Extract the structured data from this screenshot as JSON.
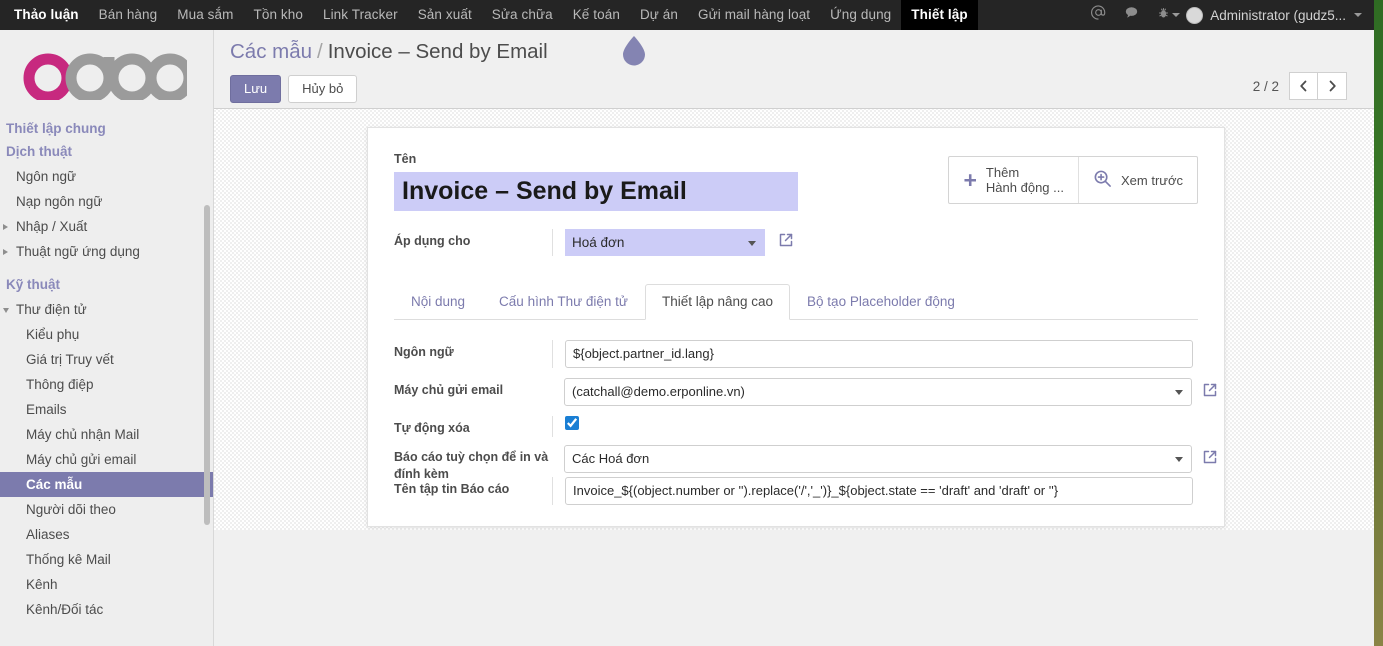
{
  "topbar": {
    "menus": [
      {
        "label": "Thảo luận",
        "state": "first"
      },
      {
        "label": "Bán hàng",
        "state": "normal"
      },
      {
        "label": "Mua sắm",
        "state": "normal"
      },
      {
        "label": "Tồn kho",
        "state": "normal"
      },
      {
        "label": "Link Tracker",
        "state": "normal"
      },
      {
        "label": "Sản xuất",
        "state": "normal"
      },
      {
        "label": "Sửa chữa",
        "state": "normal"
      },
      {
        "label": "Kế toán",
        "state": "normal"
      },
      {
        "label": "Dự án",
        "state": "normal"
      },
      {
        "label": "Gửi mail hàng loạt",
        "state": "normal"
      },
      {
        "label": "Ứng dụng",
        "state": "normal"
      },
      {
        "label": "Thiết lập",
        "state": "active"
      }
    ],
    "icons": [
      {
        "name": "at-icon",
        "glyph": "@"
      },
      {
        "name": "chat-bubble-icon",
        "glyph": "💬"
      },
      {
        "name": "bug-icon",
        "glyph": "⚘"
      }
    ],
    "username": "Administrator (gudz5..."
  },
  "sidebar": {
    "logo_text": "odoo",
    "items": [
      {
        "label": "Thiết lập chung",
        "type": "group",
        "name": "sidebar-group-general-settings"
      },
      {
        "label": "Dịch thuật",
        "type": "group",
        "name": "sidebar-group-translations"
      },
      {
        "label": "Ngôn ngữ",
        "type": "link",
        "name": "sidebar-item-languages",
        "arrow": "none"
      },
      {
        "label": "Nạp ngôn ngữ",
        "type": "link",
        "name": "sidebar-item-load-language",
        "arrow": "none"
      },
      {
        "label": "Nhập / Xuất",
        "type": "link",
        "name": "sidebar-item-import-export",
        "arrow": "right"
      },
      {
        "label": "Thuật ngữ ứng dụng",
        "type": "link",
        "name": "sidebar-item-application-terms",
        "arrow": "right"
      },
      {
        "label": "Kỹ thuật",
        "type": "group",
        "name": "sidebar-group-technical"
      },
      {
        "label": "Thư điện tử",
        "type": "link",
        "name": "sidebar-item-email",
        "arrow": "down"
      },
      {
        "label": "Kiểu phụ",
        "type": "link2",
        "name": "sidebar-item-subtypes",
        "arrow": "none"
      },
      {
        "label": "Giá trị Truy vết",
        "type": "link2",
        "name": "sidebar-item-tracking-values",
        "arrow": "none"
      },
      {
        "label": "Thông điệp",
        "type": "link2",
        "name": "sidebar-item-messages",
        "arrow": "none"
      },
      {
        "label": "Emails",
        "type": "link2",
        "name": "sidebar-item-emails",
        "arrow": "none"
      },
      {
        "label": "Máy chủ nhận Mail",
        "type": "link2",
        "name": "sidebar-item-incoming-mail-servers",
        "arrow": "none"
      },
      {
        "label": "Máy chủ gửi email",
        "type": "link2",
        "name": "sidebar-item-outgoing-mail-servers",
        "arrow": "none"
      },
      {
        "label": "Các mẫu",
        "type": "link2-selected",
        "name": "sidebar-item-templates",
        "arrow": "none"
      },
      {
        "label": "Người dõi theo",
        "type": "link2",
        "name": "sidebar-item-followers",
        "arrow": "none"
      },
      {
        "label": "Aliases",
        "type": "link2",
        "name": "sidebar-item-aliases",
        "arrow": "none"
      },
      {
        "label": "Thống kê Mail",
        "type": "link2",
        "name": "sidebar-item-mail-statistics",
        "arrow": "none"
      },
      {
        "label": "Kênh",
        "type": "link2",
        "name": "sidebar-item-channels",
        "arrow": "none"
      },
      {
        "label": "Kênh/Đối tác",
        "type": "link2",
        "name": "sidebar-item-channel-partners",
        "arrow": "none"
      }
    ]
  },
  "breadcrumb": {
    "parent": "Các mẫu",
    "separator": "/",
    "current": "Invoice – Send by Email"
  },
  "actions": {
    "save_label": "Lưu",
    "discard_label": "Hủy bỏ"
  },
  "pager": {
    "count": "2 / 2",
    "prev_glyph": "‹",
    "next_glyph": "›"
  },
  "form": {
    "name_label": "Tên",
    "name_value": "Invoice – Send by Email",
    "applies_to_label": "Áp dụng cho",
    "applies_to_value": "Hoá đơn",
    "buttonbox": [
      {
        "name": "add-action-button",
        "line1": "Thêm",
        "line2": "Hành động ...",
        "icon": "plus-icon"
      },
      {
        "name": "preview-button",
        "line1": "Xem trước",
        "line2": "",
        "icon": "magnifier-icon"
      }
    ],
    "tabs": [
      {
        "label": "Nội dung",
        "name": "tab-content",
        "active": false
      },
      {
        "label": "Cấu hình Thư điện tử",
        "name": "tab-email-configuration",
        "active": false
      },
      {
        "label": "Thiết lập nâng cao",
        "name": "tab-advanced-settings",
        "active": true
      },
      {
        "label": "Bộ tạo Placeholder động",
        "name": "tab-dynamic-placeholder-generator",
        "active": false
      }
    ],
    "fields": [
      {
        "label": "Ngôn ngữ",
        "value": "${object.partner_id.lang}",
        "type": "text",
        "name": "language-field"
      },
      {
        "label": "Máy chủ gửi email",
        "value": "(catchall@demo.erponline.vn)",
        "type": "select",
        "name": "outgoing-mail-server-field"
      },
      {
        "label": "Tự động xóa",
        "value": "",
        "type": "checkbox",
        "checked": true,
        "name": "auto-delete-field"
      },
      {
        "label": "Báo cáo tuỳ chọn để in và đính kèm",
        "value": "Các Hoá đơn",
        "type": "select",
        "name": "optional-report-field"
      },
      {
        "label": "Tên tập tin Báo cáo",
        "value": "Invoice_${(object.number or '').replace('/','_')}_${object.state == 'draft' and 'draft' or ''}",
        "type": "text",
        "name": "report-filename-field"
      }
    ]
  },
  "colors": {
    "odoo_purple": "#7c7bad",
    "logo_pink": "#c7297f",
    "topbar_bg": "#252525",
    "selected_field_bg": "#ccccf7",
    "desktop_green": "#3c7b28"
  }
}
